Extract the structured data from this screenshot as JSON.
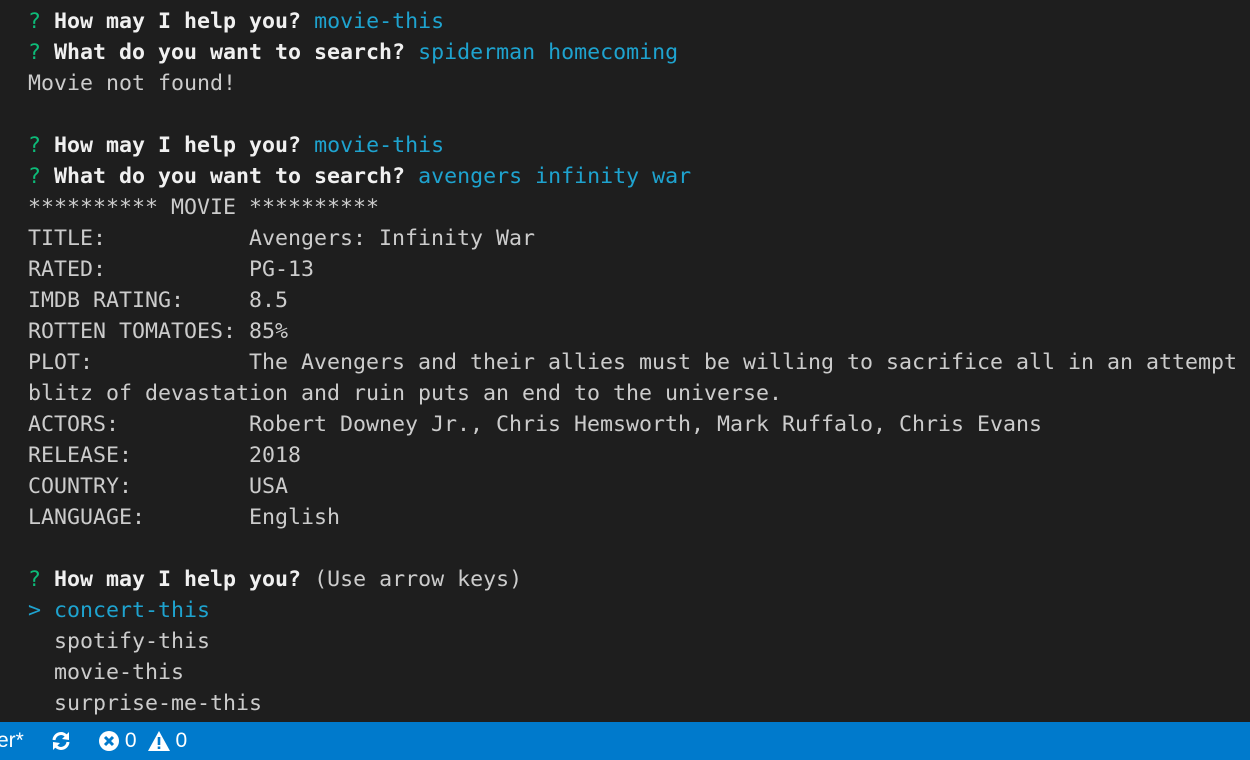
{
  "terminal": {
    "prompt_symbol": "?",
    "select_symbol": ">",
    "help_question": "How may I help you?",
    "search_question": "What do you want to search?",
    "session1": {
      "choice": "movie-this",
      "query": "spiderman homecoming",
      "result": "Movie not found!"
    },
    "session2": {
      "choice": "movie-this",
      "query": "avengers infinity war"
    },
    "movie_header": "********** MOVIE **********",
    "movie": [
      {
        "label": "TITLE:",
        "value": "Avengers: Infinity War"
      },
      {
        "label": "RATED:",
        "value": "PG-13"
      },
      {
        "label": "IMDB RATING:",
        "value": "8.5"
      },
      {
        "label": "ROTTEN TOMATOES:",
        "value": "85%"
      },
      {
        "label": "PLOT:",
        "value": "The Avengers and their allies must be willing to sacrifice all in an attempt"
      },
      {
        "label": "",
        "value": "blitz of devastation and ruin puts an end to the universe."
      },
      {
        "label": "ACTORS:",
        "value": "Robert Downey Jr., Chris Hemsworth, Mark Ruffalo, Chris Evans"
      },
      {
        "label": "RELEASE:",
        "value": "2018"
      },
      {
        "label": "COUNTRY:",
        "value": "USA"
      },
      {
        "label": "LANGUAGE:",
        "value": "English"
      }
    ],
    "session3": {
      "hint": "(Use arrow keys)"
    },
    "menu": [
      "concert-this",
      "spotify-this",
      "movie-this",
      "surprise-me-this"
    ],
    "menu_selected": 0
  },
  "statusbar": {
    "branch": "er*",
    "errors": "0",
    "warnings": "0",
    "icons": [
      "sync-icon",
      "error-icon",
      "warning-icon"
    ],
    "background": "#007acc"
  },
  "colors": {
    "background": "#1e1e1e",
    "text": "#cccccc",
    "prompt_green": "#0dbc79",
    "answer_cyan": "#1ea3cf"
  }
}
